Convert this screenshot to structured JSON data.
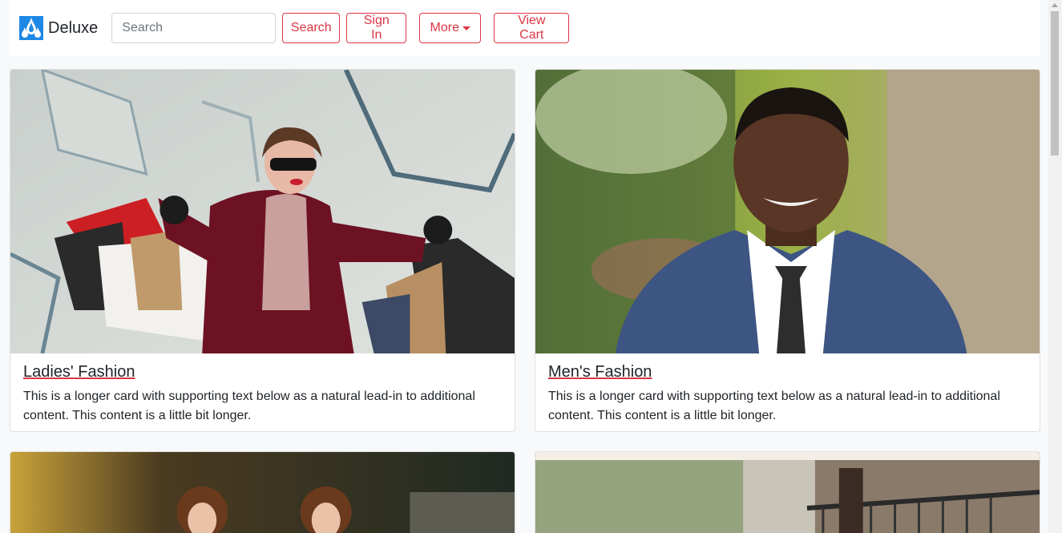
{
  "navbar": {
    "brand": "Deluxe",
    "search_placeholder": "Search",
    "search_button": "Search",
    "signin_button": "Sign In",
    "more_button": "More",
    "cart_button": "View Cart"
  },
  "cards": [
    {
      "title": "Ladies' Fashion",
      "text": "This is a longer card with supporting text below as a natural lead-in to additional content. This content is a little bit longer."
    },
    {
      "title": "Men's Fashion",
      "text": "This is a longer card with supporting text below as a natural lead-in to additional content. This content is a little bit longer."
    }
  ],
  "colors": {
    "accent": "#dc3545",
    "logo": "#1e88e5",
    "background": "#f8f9fa"
  }
}
